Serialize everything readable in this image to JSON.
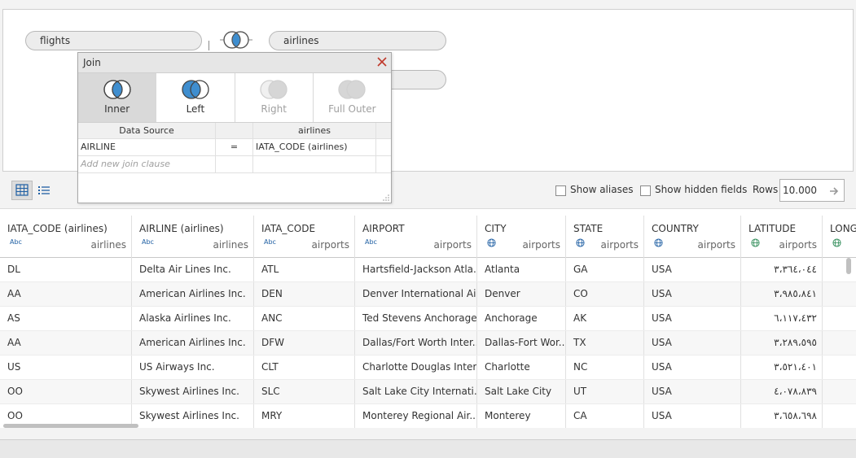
{
  "canvas": {
    "left_table": "flights",
    "right_table": "airlines"
  },
  "join_dialog": {
    "title": "Join",
    "types": [
      {
        "label": "Inner",
        "state": "selected"
      },
      {
        "label": "Left",
        "state": "normal"
      },
      {
        "label": "Right",
        "state": "disabled"
      },
      {
        "label": "Full Outer",
        "state": "disabled"
      }
    ],
    "grid": {
      "left_header": "Data Source",
      "right_header": "airlines",
      "clauses": [
        {
          "left": "AIRLINE",
          "op": "=",
          "right": "IATA_CODE (airlines)"
        }
      ],
      "add_placeholder": "Add new join clause"
    }
  },
  "toolbar": {
    "show_aliases": "Show aliases",
    "show_hidden": "Show hidden fields",
    "rows_label": "Rows",
    "rows_value": "10.000"
  },
  "table": {
    "columns": [
      {
        "name": "IATA_CODE (airlines)",
        "type": "Abc",
        "source": "airlines"
      },
      {
        "name": "AIRLINE (airlines)",
        "type": "Abc",
        "source": "airlines"
      },
      {
        "name": "IATA_CODE",
        "type": "Abc",
        "source": "airports"
      },
      {
        "name": "AIRPORT",
        "type": "Abc",
        "source": "airports"
      },
      {
        "name": "CITY",
        "type": "globe",
        "source": "airports"
      },
      {
        "name": "STATE",
        "type": "globe",
        "source": "airports"
      },
      {
        "name": "COUNTRY",
        "type": "globe",
        "source": "airports"
      },
      {
        "name": "LATITUDE",
        "type": "globe-green",
        "source": "airports"
      },
      {
        "name": "LONG",
        "type": "globe-green",
        "source": ""
      }
    ],
    "rows": [
      [
        "DL",
        "Delta Air Lines Inc.",
        "ATL",
        "Hartsfield-Jackson Atla...",
        "Atlanta",
        "GA",
        "USA",
        "٣،٣٦٤،٠٤٤",
        ""
      ],
      [
        "AA",
        "American Airlines Inc.",
        "DEN",
        "Denver International Ai...",
        "Denver",
        "CO",
        "USA",
        "٣،٩٨٥،٨٤١",
        ""
      ],
      [
        "AS",
        "Alaska Airlines Inc.",
        "ANC",
        "Ted Stevens Anchorage...",
        "Anchorage",
        "AK",
        "USA",
        "٦،١١٧،٤٣٢",
        ""
      ],
      [
        "AA",
        "American Airlines Inc.",
        "DFW",
        "Dallas/Fort Worth Inter...",
        "Dallas-Fort Wor...",
        "TX",
        "USA",
        "٣،٢٨٩،٥٩٥",
        ""
      ],
      [
        "US",
        "US Airways Inc.",
        "CLT",
        "Charlotte Douglas Inter...",
        "Charlotte",
        "NC",
        "USA",
        "٣،٥٢١،٤٠١",
        ""
      ],
      [
        "OO",
        "Skywest Airlines Inc.",
        "SLC",
        "Salt Lake City Internati...",
        "Salt Lake City",
        "UT",
        "USA",
        "٤،٠٧٨،٨٣٩",
        ""
      ],
      [
        "OO",
        "Skywest Airlines Inc.",
        "MRY",
        "Monterey Regional Air...",
        "Monterey",
        "CA",
        "USA",
        "٣،٦٥٨،٦٩٨",
        ""
      ]
    ]
  }
}
